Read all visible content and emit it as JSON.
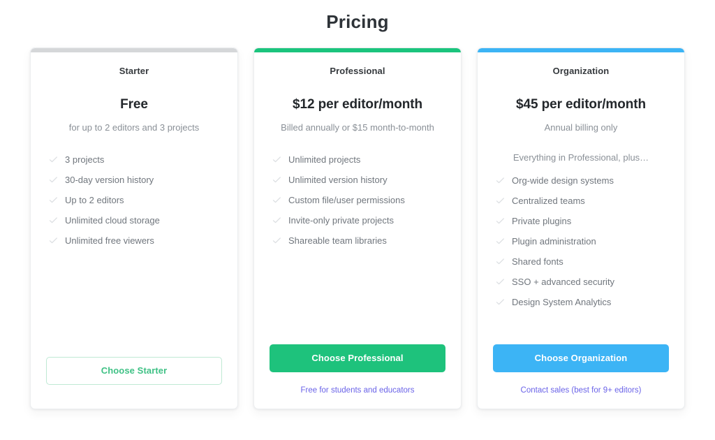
{
  "page": {
    "title": "Pricing"
  },
  "icons": {
    "check": "check-icon"
  },
  "colors": {
    "starter_accent": "#d5d7d9",
    "professional_accent": "#1bc47d",
    "organization_accent": "#3cb4f5",
    "outline_button_text": "#3fc185",
    "solid_green": "#1ec27c",
    "solid_blue": "#3cb4f5",
    "link_purple": "#6a63e8",
    "feature_text": "#70767d",
    "subtitle_text": "#8a9097"
  },
  "plans": [
    {
      "id": "starter",
      "name": "Starter",
      "price": "Free",
      "subtitle": "for up to 2 editors and 3 projects",
      "features_lead": "",
      "features": [
        "3 projects",
        "30-day version history",
        "Up to 2 editors",
        "Unlimited cloud storage",
        "Unlimited free viewers"
      ],
      "cta_label": "Choose Starter",
      "footer_link": ""
    },
    {
      "id": "professional",
      "name": "Professional",
      "price": "$12 per editor/month",
      "subtitle": "Billed annually or $15 month-to-month",
      "features_lead": "",
      "features": [
        "Unlimited projects",
        "Unlimited version history",
        "Custom file/user permissions",
        "Invite-only private projects",
        "Shareable team libraries"
      ],
      "cta_label": "Choose Professional",
      "footer_link": "Free for students and educators"
    },
    {
      "id": "organization",
      "name": "Organization",
      "price": "$45 per editor/month",
      "subtitle": "Annual billing only",
      "features_lead": "Everything in Professional, plus…",
      "features": [
        "Org-wide design systems",
        "Centralized teams",
        "Private plugins",
        "Plugin administration",
        "Shared fonts",
        "SSO + advanced security",
        "Design System Analytics"
      ],
      "cta_label": "Choose Organization",
      "footer_link": "Contact sales (best for 9+ editors)"
    }
  ]
}
